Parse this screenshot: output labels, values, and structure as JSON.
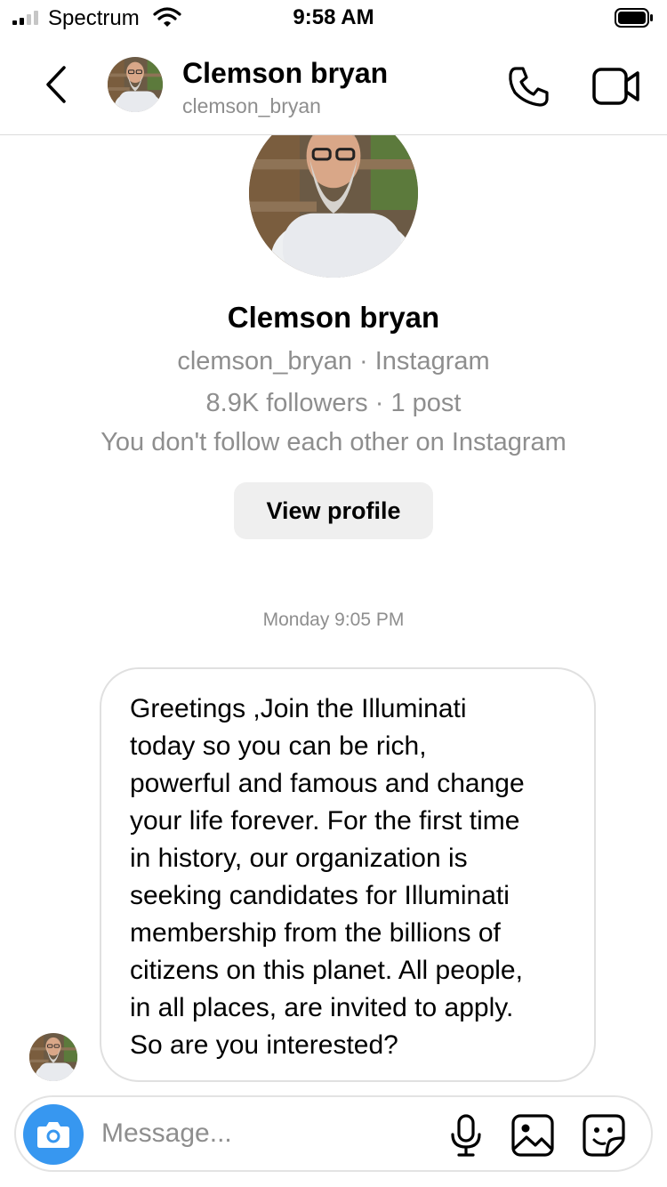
{
  "status_bar": {
    "carrier": "Spectrum",
    "time": "9:58 AM",
    "signal_bars": 2,
    "signal_total": 4
  },
  "header": {
    "name": "Clemson bryan",
    "handle": "clemson_bryan",
    "icons": [
      "back-icon",
      "phone-icon",
      "video-camera-icon"
    ]
  },
  "profile": {
    "name": "Clemson bryan",
    "handle_line": "clemson_bryan · Instagram",
    "stats_line": "8.9K followers · 1 post",
    "relationship_line": "You don't follow each other on Instagram",
    "view_profile_label": "View profile"
  },
  "thread": {
    "timestamp": "Monday 9:05 PM",
    "messages": [
      {
        "text": "Greetings ,Join the Illuminati\ntoday so you can be rich,\npowerful and famous and change\nyour life forever. For the first time\nin history, our organization is\nseeking candidates for Illuminati\nmembership from the billions of\ncitizens on this planet. All people,\nin all places, are invited to apply.\nSo are you interested?"
      }
    ]
  },
  "composer": {
    "placeholder": "Message...",
    "icons": [
      "camera-icon",
      "microphone-icon",
      "gallery-icon",
      "sticker-icon"
    ]
  },
  "colors": {
    "accent": "#3797f0",
    "secondary_text": "#8e8e8e",
    "button_bg": "#efefef",
    "divider": "#dbdbdb"
  }
}
